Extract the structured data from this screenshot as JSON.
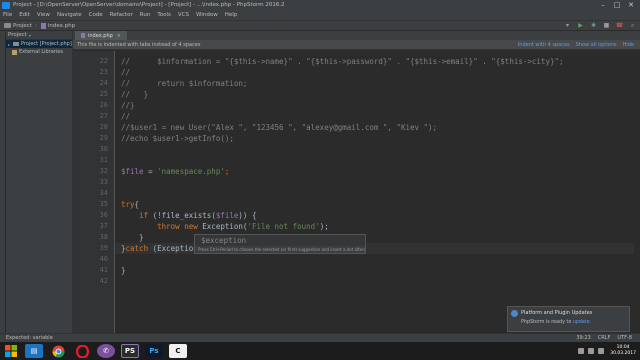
{
  "window": {
    "title": "Project - [D:\\OpenServer\\OpenServer\\domains\\Project] - [Project] - ...\\index.php - PhpStorm 2016.2"
  },
  "menu": [
    "File",
    "Edit",
    "View",
    "Navigate",
    "Code",
    "Refactor",
    "Run",
    "Tools",
    "VCS",
    "Window",
    "Help"
  ],
  "breadcrumb": {
    "folder": "Project",
    "file": "index.php"
  },
  "project_panel": {
    "header": "Project",
    "items": [
      {
        "label": "Project [Project.php]",
        "selected": true
      },
      {
        "label": "External Libraries",
        "selected": false
      }
    ]
  },
  "tab": {
    "label": "index.php"
  },
  "banner": {
    "text": "This file is indented with tabs instead of 4 spaces",
    "link1": "Indent with 4 spaces",
    "link2": "Show all options",
    "link3": "Hide"
  },
  "code": {
    "line_numbers": [
      "22",
      "23",
      "24",
      "25",
      "26",
      "27",
      "28",
      "29",
      "30",
      "31",
      "32",
      "33",
      "34",
      "35",
      "36",
      "37",
      "38",
      "39",
      "40",
      "41",
      "42"
    ],
    "lines": [
      [
        {
          "t": "//      ",
          "c": "comment"
        },
        {
          "t": "$information = \"{$this->name}\" . \"{$this->password}\" . \"{$this->email}\" . \"{$this->city}\";",
          "c": "comment"
        }
      ],
      [
        {
          "t": "//",
          "c": "comment"
        }
      ],
      [
        {
          "t": "//      return $information;",
          "c": "comment"
        }
      ],
      [
        {
          "t": "//   }",
          "c": "comment"
        }
      ],
      [
        {
          "t": "//}",
          "c": "comment"
        }
      ],
      [
        {
          "t": "//",
          "c": "comment"
        }
      ],
      [
        {
          "t": "//$user1 = new User(\"Alex \", \"123456 \", \"alexey@gmail.com \", \"Kiev \");",
          "c": "comment"
        }
      ],
      [
        {
          "t": "//echo $user1->getInfo();",
          "c": "comment"
        }
      ],
      [
        {
          "t": "",
          "c": "plain"
        }
      ],
      [
        {
          "t": "",
          "c": "plain"
        }
      ],
      [
        {
          "t": "$file",
          "c": "var"
        },
        {
          "t": " = ",
          "c": "plain"
        },
        {
          "t": "'namespace.php'",
          "c": "str"
        },
        {
          "t": ";",
          "c": "kw"
        }
      ],
      [
        {
          "t": "",
          "c": "plain"
        }
      ],
      [
        {
          "t": "",
          "c": "plain"
        }
      ],
      [
        {
          "t": "try",
          "c": "kw"
        },
        {
          "t": "{",
          "c": "plain"
        }
      ],
      [
        {
          "t": "    ",
          "c": "plain"
        },
        {
          "t": "if",
          "c": "kw"
        },
        {
          "t": " (!",
          "c": "plain"
        },
        {
          "t": "file_exists",
          "c": "fn"
        },
        {
          "t": "(",
          "c": "plain"
        },
        {
          "t": "$file",
          "c": "var"
        },
        {
          "t": ")) {",
          "c": "plain"
        }
      ],
      [
        {
          "t": "        ",
          "c": "plain"
        },
        {
          "t": "throw new ",
          "c": "kw"
        },
        {
          "t": "Exception(",
          "c": "plain"
        },
        {
          "t": "'File not found'",
          "c": "str"
        },
        {
          "t": ");",
          "c": "plain"
        }
      ],
      [
        {
          "t": "    }",
          "c": "plain"
        }
      ],
      [
        {
          "t": "}",
          "c": "plain"
        },
        {
          "t": "catch",
          "c": "kw"
        },
        {
          "t": " (Exception ",
          "c": "plain"
        },
        {
          "t": "$e",
          "c": "var"
        },
        {
          "t": "){",
          "c": "plain"
        }
      ],
      [
        {
          "t": "",
          "c": "plain"
        }
      ],
      [
        {
          "t": "}",
          "c": "plain"
        }
      ],
      [
        {
          "t": "",
          "c": "plain"
        }
      ]
    ]
  },
  "completion": {
    "item": "$exception",
    "hint": "Press Ctrl+Period to choose the selected (or first) suggestion and insert a dot afterwards  >>  π"
  },
  "notification": {
    "title": "Platform and Plugin Updates",
    "body": "PhpStorm is ready to",
    "link": "update."
  },
  "status": {
    "left": "Expected: variable",
    "position": "39:23",
    "line_sep": "CRLF",
    "encoding": "UTF-8"
  },
  "taskbar": {
    "time": "10:04",
    "date": "30.03.2017"
  }
}
